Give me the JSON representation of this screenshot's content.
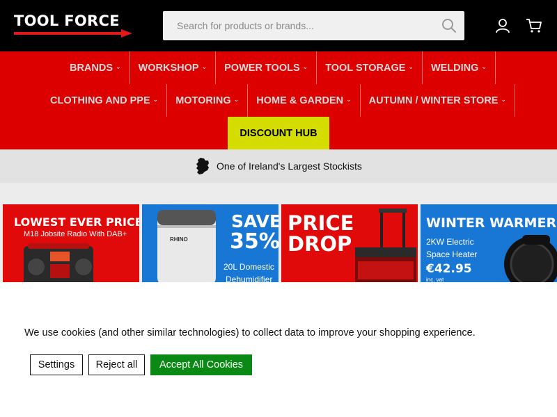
{
  "header": {
    "logo": {
      "part1": "TOOL",
      "part2": "FORCE"
    },
    "search_placeholder": "Search for products or brands...",
    "icons": {
      "search": "search-icon",
      "account": "user-icon",
      "cart": "cart-icon"
    }
  },
  "nav": {
    "row1": [
      "BRANDS",
      "WORKSHOP",
      "POWER TOOLS",
      "TOOL STORAGE",
      "WELDING"
    ],
    "row2": [
      "CLOTHING AND PPE",
      "MOTORING",
      "HOME & GARDEN",
      "AUTUMN / WINTER STORE"
    ],
    "discount": "DISCOUNT HUB",
    "chevron": "⌄"
  },
  "stockist": {
    "icon": "ireland-map-icon",
    "text": "One of Ireland's Largest Stockists"
  },
  "banners": [
    {
      "headline": "LOWEST EVER PRICE",
      "sub": "M18 Jobsite Radio With DAB+"
    },
    {
      "brand": "RHINO",
      "headline1": "SAVE",
      "headline2": "35%",
      "sub1": "20L Domestic",
      "sub2": "Dehumidifier"
    },
    {
      "headline1": "PRICE",
      "headline2": "DROP"
    },
    {
      "headline": "WINTER WARMER",
      "sub1": "2KW Electric",
      "sub2": "Space Heater",
      "price": "€42.95",
      "price_note": "inc. vat"
    }
  ],
  "cookie": {
    "message": "We use cookies (and other similar technologies) to collect data to improve your shopping experience.",
    "settings": "Settings",
    "reject": "Reject all",
    "accept": "Accept All Cookies"
  },
  "colors": {
    "header_bg": "#000000",
    "nav_bg": "#dd0000",
    "discount_bg": "#d4dc00",
    "accept_bg": "#0a8a14",
    "banner_red": "#e10a0a",
    "banner_blue": "#1877d4"
  }
}
